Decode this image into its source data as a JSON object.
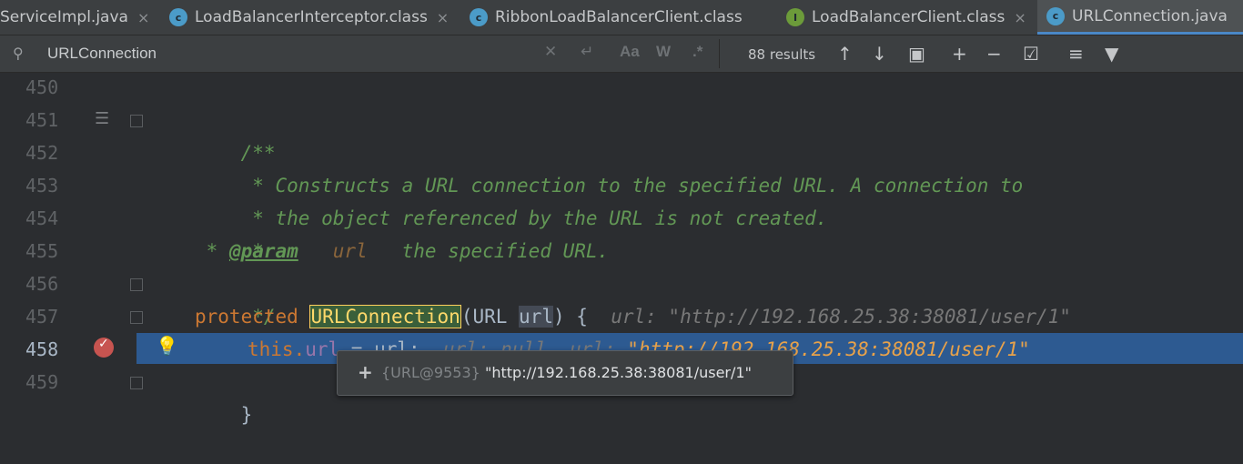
{
  "tabs": [
    {
      "label": "ServiceImpl.java",
      "icon": "",
      "close": "×",
      "active": false
    },
    {
      "label": "LoadBalancerInterceptor.class",
      "icon": "c",
      "close": "×",
      "active": false
    },
    {
      "label": "RibbonLoadBalancerClient.class",
      "icon": "c",
      "close": "",
      "active": false
    },
    {
      "label": "LoadBalancerClient.class",
      "icon": "I",
      "close": "×",
      "active": false
    },
    {
      "label": "URLConnection.java",
      "icon": "c",
      "close": "",
      "active": true
    }
  ],
  "search": {
    "query": "URLConnection",
    "match_case": "Aa",
    "words": "W",
    "regex": ".*",
    "results": "88 results"
  },
  "lines": [
    "450",
    "451",
    "452",
    "453",
    "454",
    "455",
    "456",
    "457",
    "458",
    "459"
  ],
  "code": {
    "l451": "/**",
    "l452": " * Constructs a URL connection to the specified URL. A connection to",
    "l453": " * the object referenced by the URL is not created.",
    "l454": " *",
    "l455_star": " * ",
    "l455_tag": "@param",
    "l455_name": "url",
    "l455_desc": "the specified URL.",
    "l456": " */",
    "l457_kw": "protected",
    "l457_name": "URLConnection",
    "l457_open": "(URL ",
    "l457_param": "url",
    "l457_close": ") {",
    "l457_inlay": "url: \"http://192.168.25.38:38081/user/1\"",
    "l458_this": "this.",
    "l458_field": "url",
    "l458_assign": " = url;",
    "l458_inlay1": "url: null",
    "l458_inlay2_label": "url: ",
    "l458_inlay2_val": "\"http://192.168.25.38:38081/user/1\"",
    "l459": "}"
  },
  "tooltip": {
    "plus": "+",
    "ref": "{URL@9553}",
    "value": "\"http://192.168.25.38:38081/user/1\""
  }
}
